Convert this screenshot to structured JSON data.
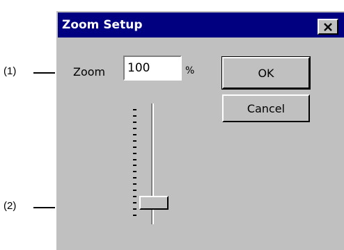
{
  "callouts": {
    "one": "(1)",
    "two": "(2)"
  },
  "dialog": {
    "title": "Zoom Setup",
    "close_icon": "close-icon",
    "zoom_label": "Zoom",
    "zoom_value": "100",
    "unit": "%",
    "ok_label": "OK",
    "cancel_label": "Cancel"
  },
  "slider": {
    "value_percent": 100,
    "tick_count": 18
  },
  "colors": {
    "titlebar": "#000080",
    "dialog_bg": "#c0c0c0"
  }
}
